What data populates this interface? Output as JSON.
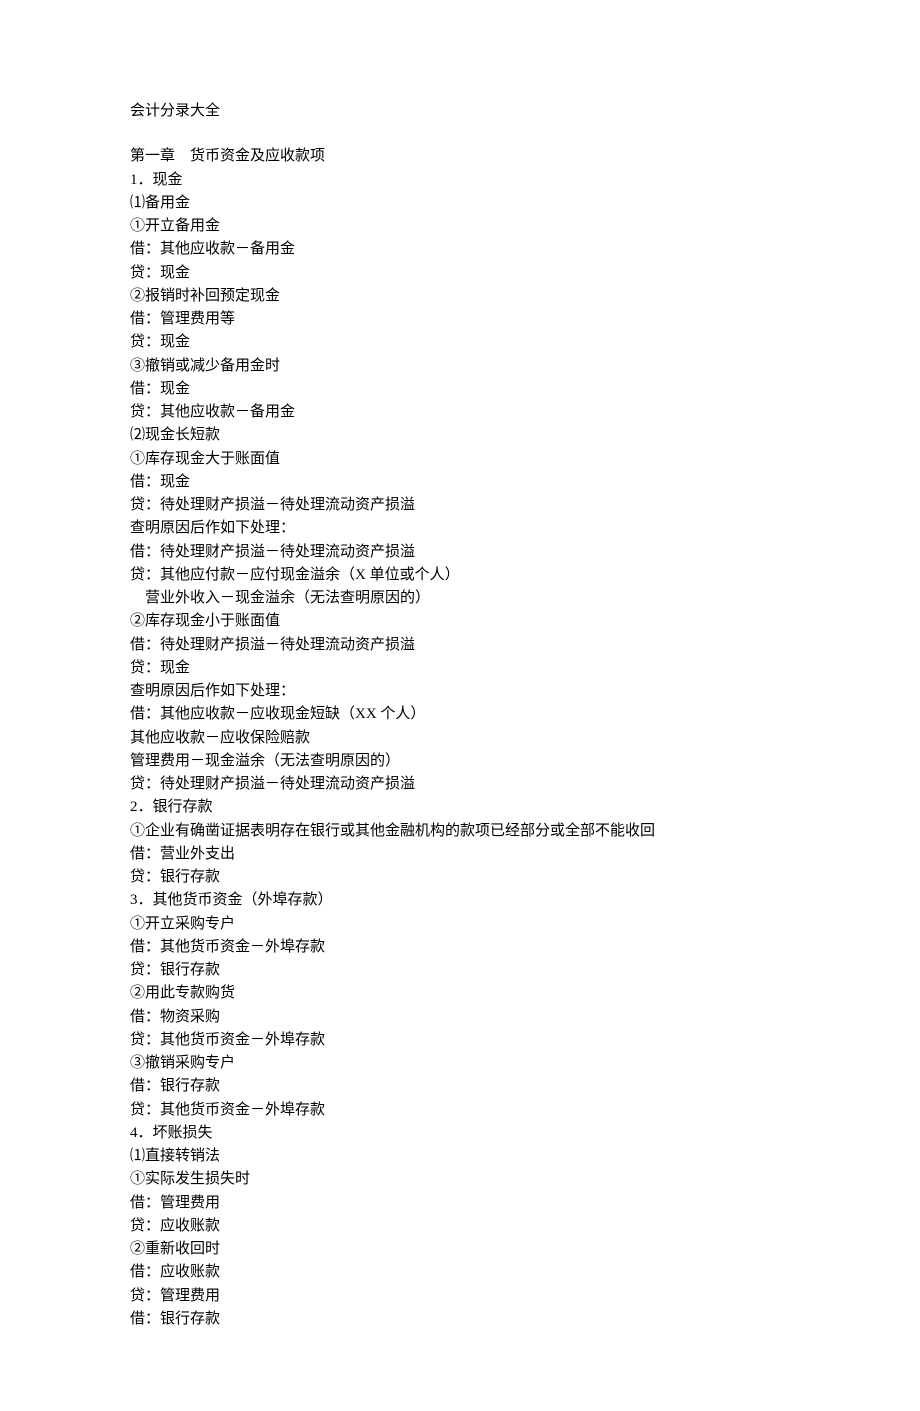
{
  "title": "会计分录大全",
  "lines": [
    "第一章    货币资金及应收款项",
    "1．现金",
    "⑴备用金",
    "①开立备用金",
    "借：其他应收款－备用金",
    "贷：现金",
    "②报销时补回预定现金",
    "借：管理费用等",
    "贷：现金",
    "③撤销或减少备用金时",
    "借：现金",
    "贷：其他应收款－备用金",
    "⑵现金长短款",
    "①库存现金大于账面值",
    "借：现金",
    "贷：待处理财产损溢－待处理流动资产损溢",
    "查明原因后作如下处理：",
    "借：待处理财产损溢－待处理流动资产损溢",
    "贷：其他应付款－应付现金溢余（X 单位或个人）",
    "    营业外收入－现金溢余（无法查明原因的）",
    "②库存现金小于账面值",
    "借：待处理财产损溢－待处理流动资产损溢",
    "贷：现金",
    "查明原因后作如下处理：",
    "借：其他应收款－应收现金短缺（XX 个人）",
    "其他应收款－应收保险赔款",
    "管理费用－现金溢余（无法查明原因的）",
    "贷：待处理财产损溢－待处理流动资产损溢",
    "2．银行存款",
    "①企业有确凿证据表明存在银行或其他金融机构的款项已经部分或全部不能收回",
    "借：营业外支出",
    "贷：银行存款",
    "3．其他货币资金（外埠存款）",
    "①开立采购专户",
    "借：其他货币资金－外埠存款",
    "贷：银行存款",
    "②用此专款购货",
    "借：物资采购",
    "贷：其他货币资金－外埠存款",
    "③撤销采购专户",
    "借：银行存款",
    "贷：其他货币资金－外埠存款",
    "4．坏账损失",
    "⑴直接转销法",
    "①实际发生损失时",
    "借：管理费用",
    "贷：应收账款",
    "②重新收回时",
    "借：应收账款",
    "贷：管理费用",
    "借：银行存款"
  ]
}
